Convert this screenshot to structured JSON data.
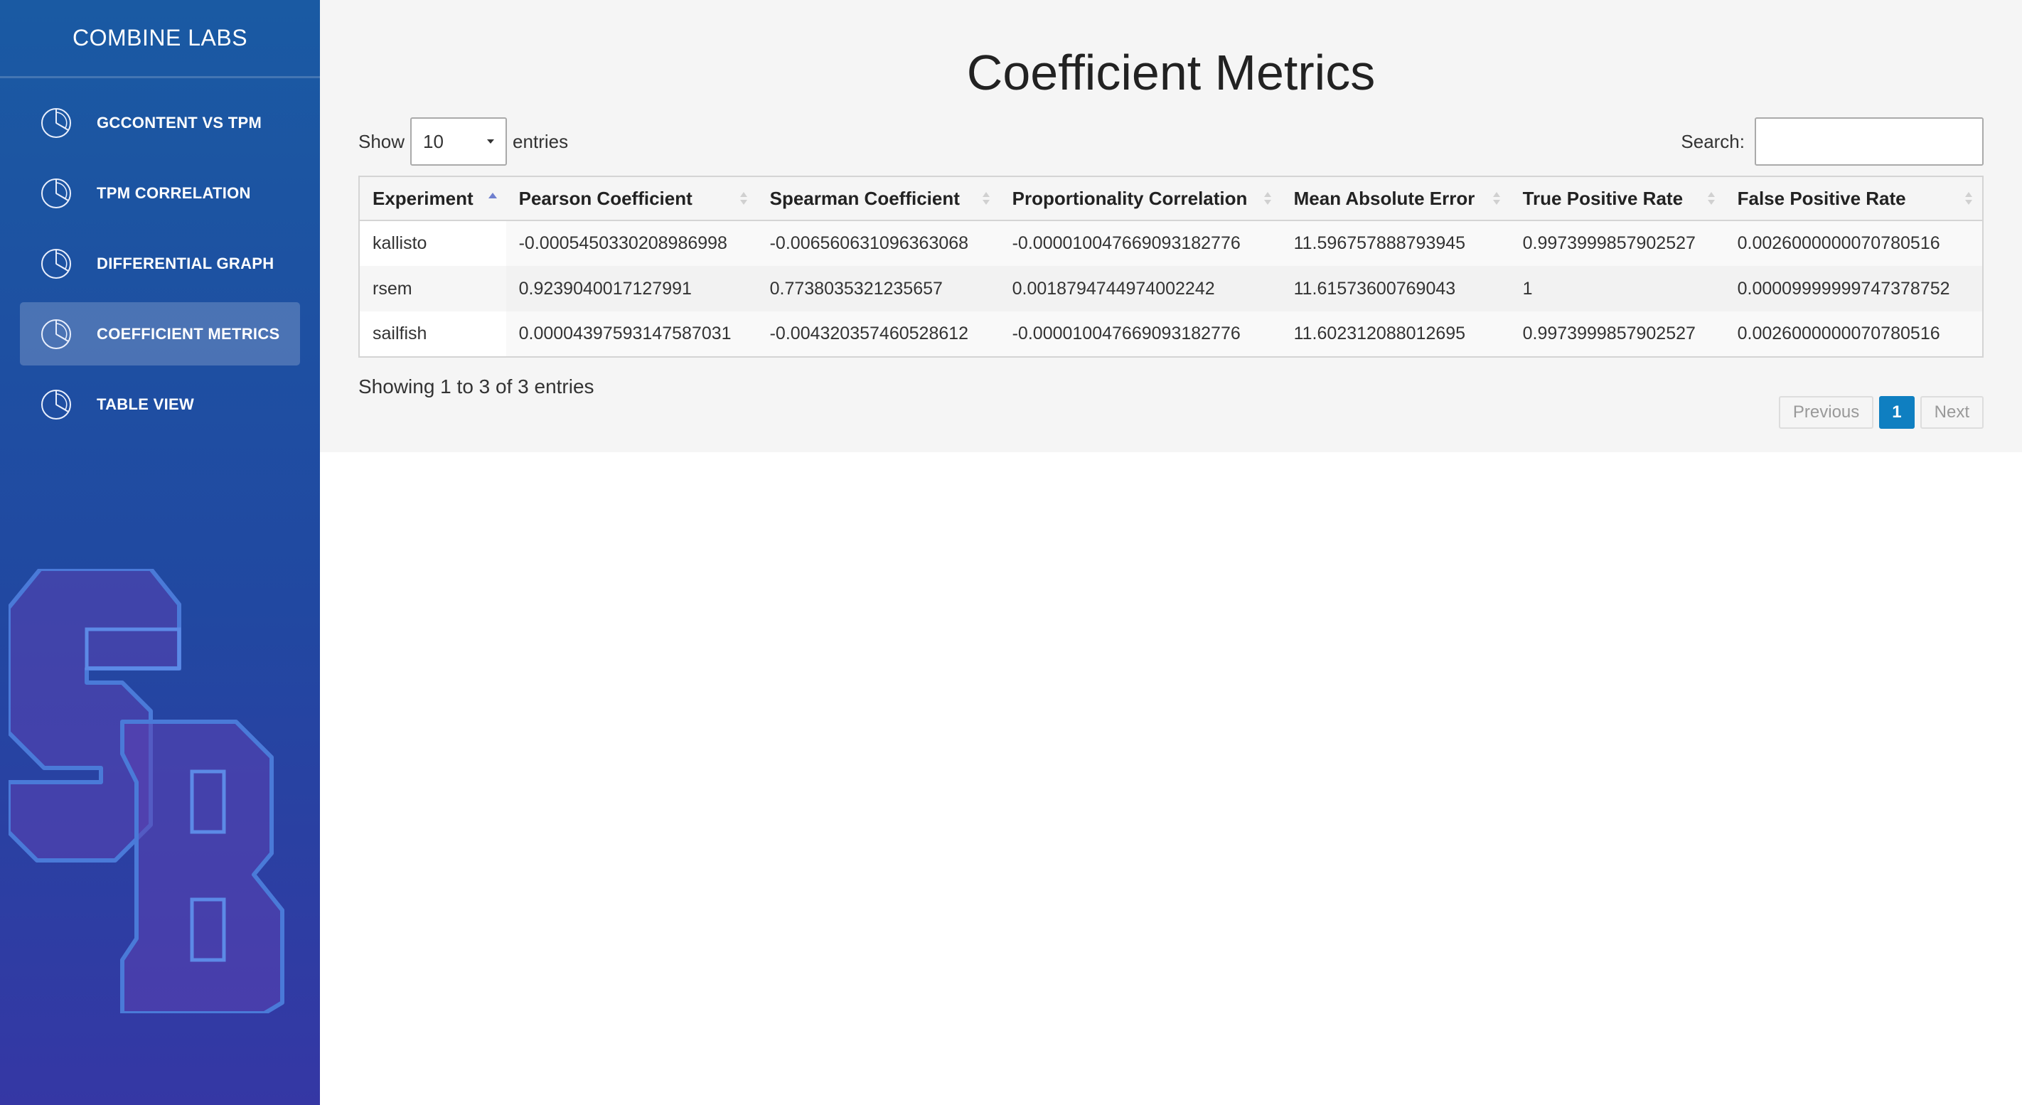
{
  "sidebar": {
    "brand": "COMBINE LABS",
    "items": [
      {
        "label": "GCCONTENT VS TPM",
        "icon": "pie-chart-icon"
      },
      {
        "label": "TPM CORRELATION",
        "icon": "pie-chart-icon"
      },
      {
        "label": "DIFFERENTIAL GRAPH",
        "icon": "pie-chart-icon"
      },
      {
        "label": "COEFFICIENT METRICS",
        "icon": "pie-chart-icon",
        "active": true
      },
      {
        "label": "TABLE VIEW",
        "icon": "pie-chart-icon"
      }
    ],
    "logo_text": "SB"
  },
  "main": {
    "title": "Coefficient Metrics",
    "length": {
      "show_label": "Show",
      "value": "10",
      "entries_label": "entries"
    },
    "search": {
      "label": "Search:",
      "value": "",
      "placeholder": ""
    },
    "table": {
      "columns": [
        "Experiment",
        "Pearson Coefficient",
        "Spearman Coefficient",
        "Proportionality Correlation",
        "Mean Absolute Error",
        "True Positive Rate",
        "False Positive Rate"
      ],
      "sorted_column": "Experiment",
      "sort_direction": "asc",
      "rows": [
        [
          "kallisto",
          "-0.0005450330208986998",
          "-0.006560631096363068",
          "-0.000010047669093182776",
          "11.596757888793945",
          "0.9973999857902527",
          "0.0026000000070780516"
        ],
        [
          "rsem",
          "0.9239040017127991",
          "0.7738035321235657",
          "0.0018794744974002242",
          "11.61573600769043",
          "1",
          "0.00009999999747378752"
        ],
        [
          "sailfish",
          "0.00004397593147587031",
          "-0.004320357460528612",
          "-0.000010047669093182776",
          "11.602312088012695",
          "0.9973999857902527",
          "0.0026000000070780516"
        ]
      ]
    },
    "info": "Showing 1 to 3 of 3 entries",
    "pagination": {
      "previous": "Previous",
      "current": "1",
      "next": "Next"
    }
  },
  "colors": {
    "sidebar_top": "#1a5aa3",
    "sidebar_bottom": "#3537a4",
    "active_page": "#0f7fc1",
    "sort_active": "#6f7fcf"
  }
}
